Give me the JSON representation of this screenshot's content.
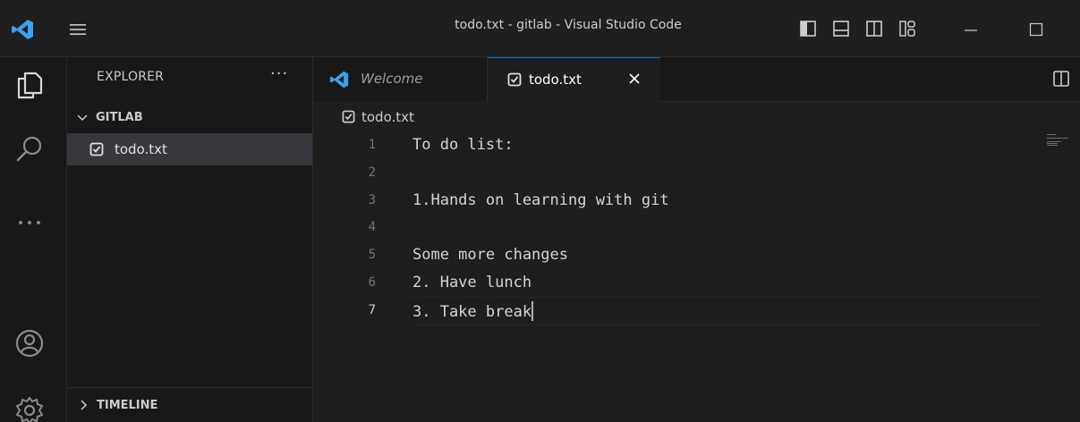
{
  "window": {
    "title": "todo.txt - gitlab - Visual Studio Code"
  },
  "sidebar": {
    "header": "EXPLORER",
    "more": "···",
    "section": "GITLAB",
    "files": [
      {
        "name": "todo.txt"
      }
    ],
    "timeline": "TIMELINE"
  },
  "tabs": [
    {
      "label": "Welcome"
    },
    {
      "label": "todo.txt"
    }
  ],
  "breadcrumb": "todo.txt",
  "editor": {
    "current_line": 7,
    "lines": [
      {
        "num": "1",
        "text": "To do list:"
      },
      {
        "num": "2",
        "text": ""
      },
      {
        "num": "3",
        "text": "1.Hands on learning with git"
      },
      {
        "num": "4",
        "text": ""
      },
      {
        "num": "5",
        "text": "Some more changes"
      },
      {
        "num": "6",
        "text": "2. Have lunch"
      },
      {
        "num": "7",
        "text": "3. Take break"
      }
    ]
  },
  "colors": {
    "accent": "#0078d4",
    "vscode_logo": "#3aa1f0",
    "editor_bg": "#1e1e1e",
    "sidebar_bg": "#181818",
    "selected_row": "#37373d"
  }
}
